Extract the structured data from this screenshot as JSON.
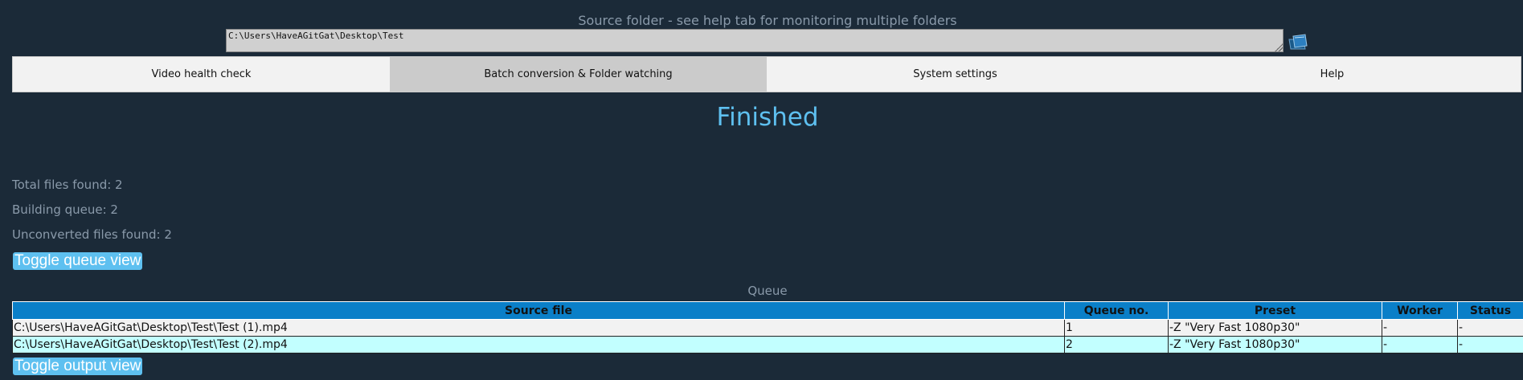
{
  "source": {
    "label": "Source folder - see help tab for monitoring multiple folders",
    "path": "C:\\Users\\HaveAGitGat\\Desktop\\Test",
    "browse_icon": "folder-icon"
  },
  "tabs": [
    {
      "label": "Video health check",
      "active": false
    },
    {
      "label": "Batch conversion & Folder watching",
      "active": true
    },
    {
      "label": "System settings",
      "active": false
    },
    {
      "label": "Help",
      "active": false
    }
  ],
  "status": {
    "title": "Finished",
    "total_files": "Total files found: 2",
    "building_queue": "Building queue: 2",
    "unconverted": "Unconverted files found: 2"
  },
  "buttons": {
    "toggle_queue": "Toggle queue view",
    "toggle_output": "Toggle output view"
  },
  "queue": {
    "caption": "Queue",
    "columns": [
      "Source file",
      "Queue no.",
      "Preset",
      "Worker",
      "Status"
    ],
    "rows": [
      [
        "C:\\Users\\HaveAGitGat\\Desktop\\Test\\Test (1).mp4",
        "1",
        "-Z \"Very Fast 1080p30\"",
        "-",
        "-"
      ],
      [
        "C:\\Users\\HaveAGitGat\\Desktop\\Test\\Test (2).mp4",
        "2",
        "-Z \"Very Fast 1080p30\"",
        "-",
        "-"
      ]
    ]
  },
  "colors": {
    "background": "#1b2a38",
    "accent": "#5ec0f0",
    "table_header": "#0a7fc8",
    "row_alt": "#c2ffff"
  }
}
